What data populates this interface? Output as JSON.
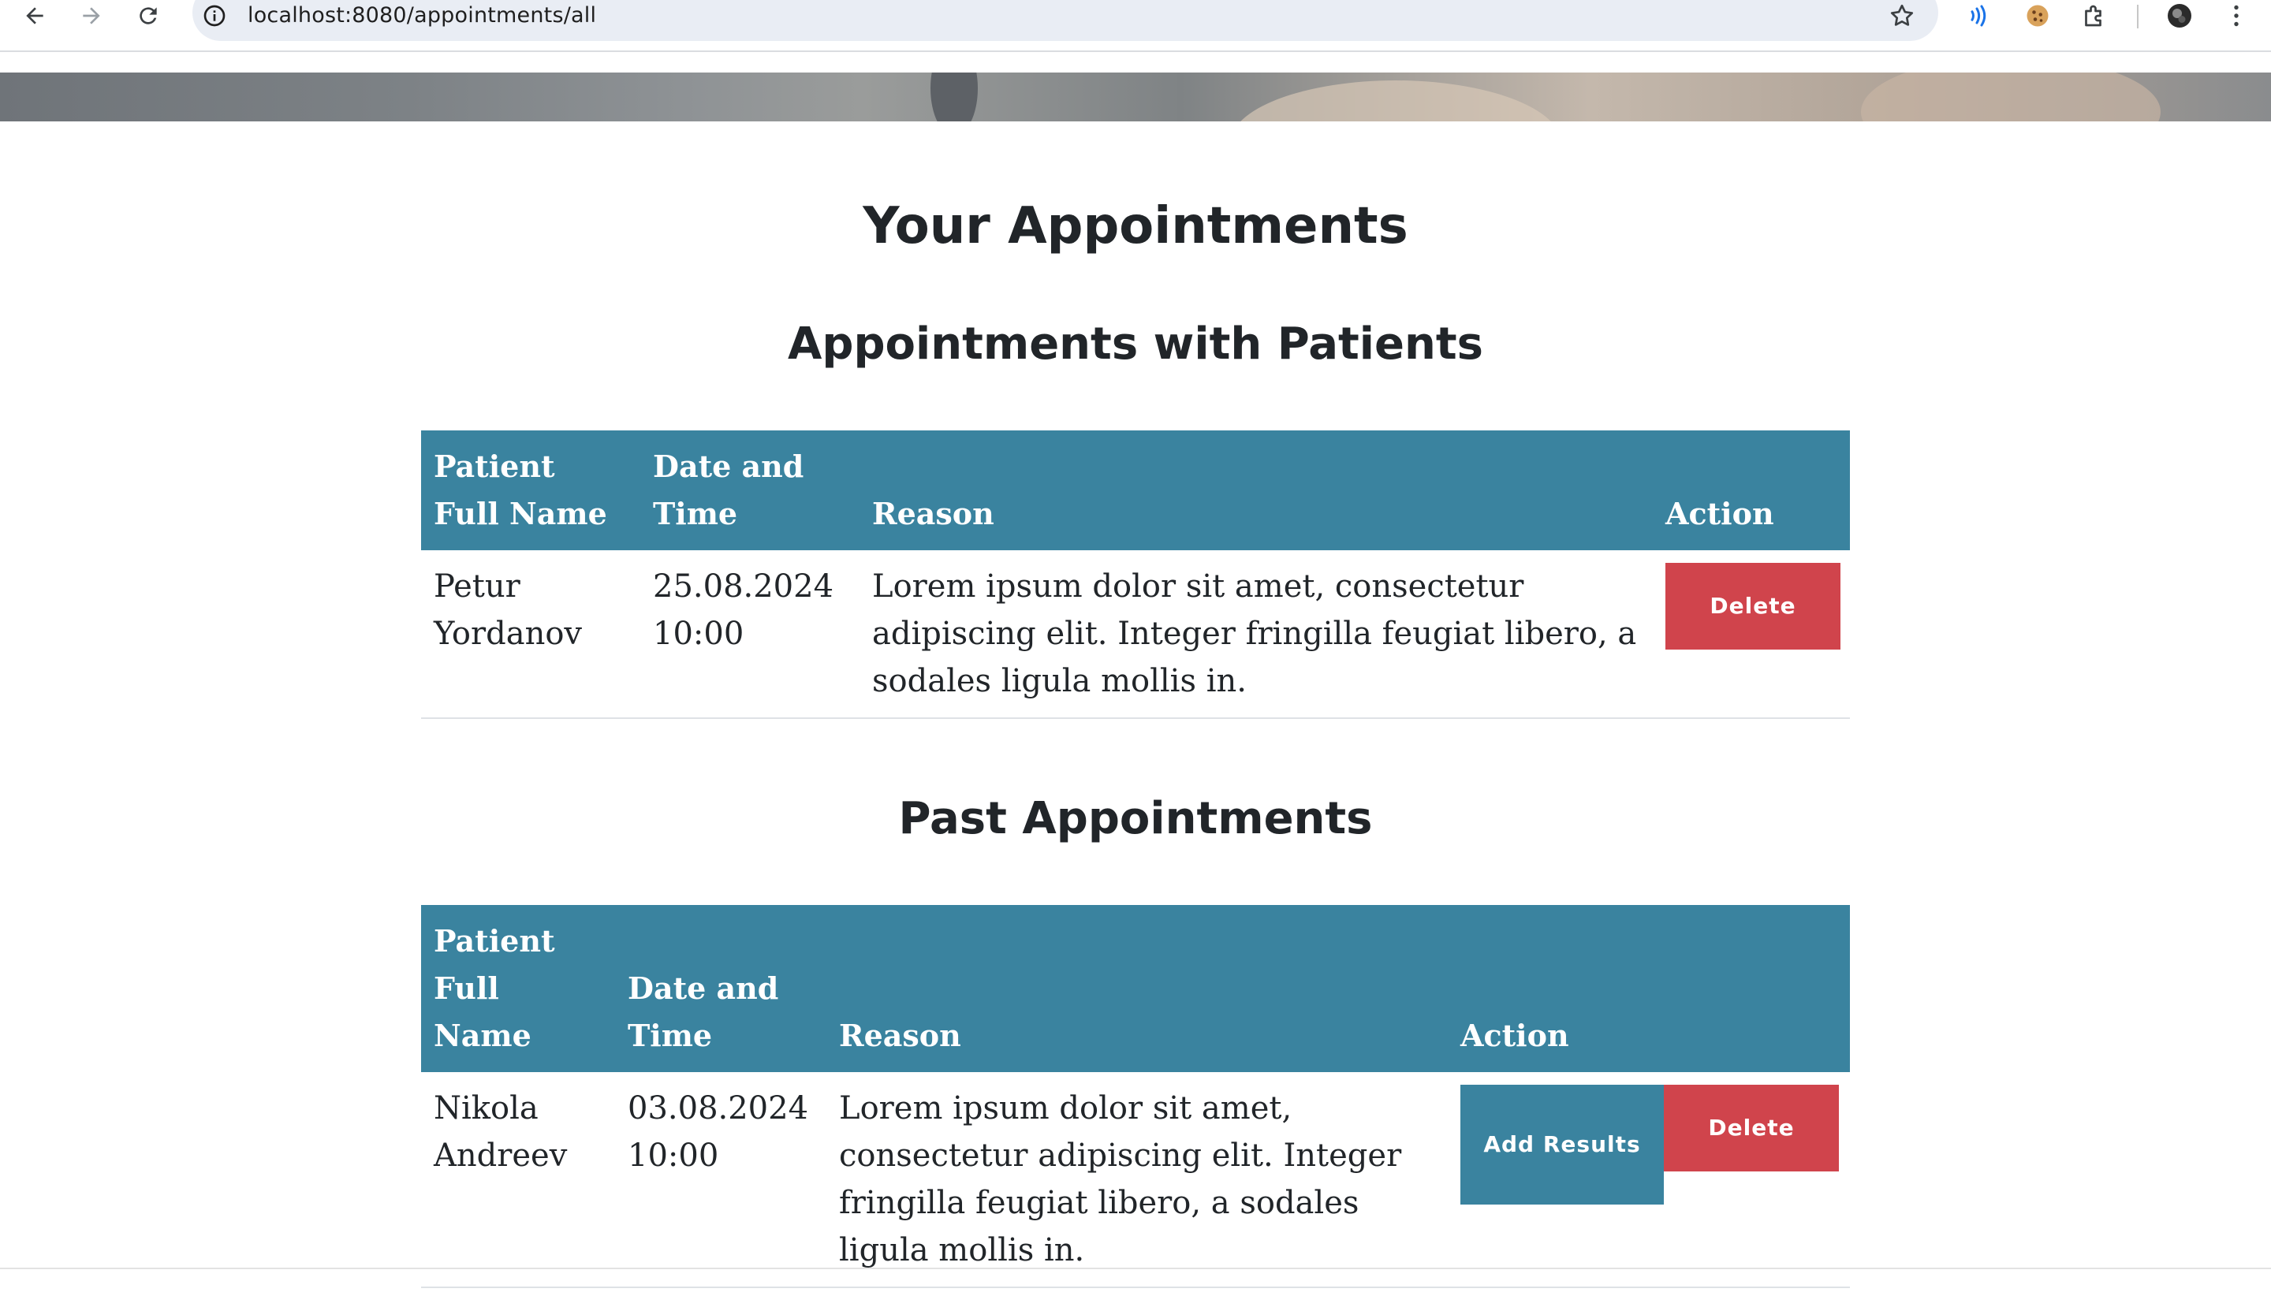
{
  "browser": {
    "url": "localhost:8080/appointments/all",
    "icons": [
      "back-arrow-icon",
      "forward-arrow-icon",
      "reload-icon",
      "site-info-icon",
      "bookmark-star-icon",
      "read-aloud-icon",
      "cookie-icon",
      "extensions-puzzle-icon",
      "profile-avatar",
      "kebab-menu-icon"
    ]
  },
  "page": {
    "title": "Your Appointments"
  },
  "upcoming": {
    "heading": "Appointments with Patients",
    "columns": [
      "Patient Full Name",
      "Date and Time",
      "Reason",
      "Action"
    ],
    "rows": [
      {
        "patient": "Petur Yordanov",
        "datetime": "25.08.2024 10:00",
        "reason": "Lorem ipsum dolor sit amet, consectetur adipiscing elit. Integer fringilla feugiat libero, a sodales ligula mollis in.",
        "delete_label": "Delete"
      }
    ]
  },
  "past": {
    "heading": "Past Appointments",
    "columns": [
      "Patient Full Name",
      "Date and Time",
      "Reason",
      "Action"
    ],
    "rows": [
      {
        "patient": "Nikola Andreev",
        "datetime": "03.08.2024 10:00",
        "reason": "Lorem ipsum dolor sit amet, consectetur adipiscing elit. Integer fringilla feugiat libero, a sodales ligula mollis in.",
        "add_results_label": "Add Results",
        "delete_label": "Delete"
      }
    ]
  },
  "colors": {
    "table_header": "#3a839f",
    "delete_button": "#d0444c",
    "add_results_button": "#3a839f",
    "heading_text": "#212529"
  }
}
